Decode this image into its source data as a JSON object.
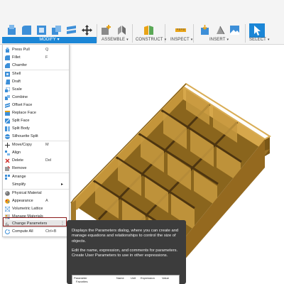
{
  "toolbar": {
    "groups": [
      {
        "label": "MODIFY"
      },
      {
        "label": "ASSEMBLE"
      },
      {
        "label": "CONSTRUCT"
      },
      {
        "label": "INSPECT"
      },
      {
        "label": "INSERT"
      },
      {
        "label": "SELECT"
      }
    ],
    "caret": "▾",
    "accent": "#1b86d6",
    "icons": [
      "press-pull-icon",
      "fillet-icon",
      "shell-icon",
      "combine-icon",
      "offset-face-icon",
      "move-icon",
      "new-component-icon",
      "joint-icon",
      "offset-plane-icon",
      "measure-icon",
      "insert-derive-icon",
      "insert-mesh-icon",
      "canvas-icon",
      "select-icon"
    ]
  },
  "menu": {
    "items": [
      {
        "label": "Press Pull",
        "shortcut": "Q",
        "icon": "press-pull-icon"
      },
      {
        "label": "Fillet",
        "shortcut": "F",
        "icon": "fillet-icon"
      },
      {
        "label": "Chamfer",
        "shortcut": "",
        "icon": "chamfer-icon"
      },
      {
        "label": "Shell",
        "shortcut": "",
        "icon": "shell-icon"
      },
      {
        "label": "Draft",
        "shortcut": "",
        "icon": "draft-icon"
      },
      {
        "label": "Scale",
        "shortcut": "",
        "icon": "scale-icon"
      },
      {
        "label": "Combine",
        "shortcut": "",
        "icon": "combine-icon"
      },
      {
        "label": "Offset Face",
        "shortcut": "",
        "icon": "offset-face-icon"
      },
      {
        "label": "Replace Face",
        "shortcut": "",
        "icon": "replace-face-icon"
      },
      {
        "label": "Split Face",
        "shortcut": "",
        "icon": "split-face-icon"
      },
      {
        "label": "Split Body",
        "shortcut": "",
        "icon": "split-body-icon"
      },
      {
        "label": "Silhouette Split",
        "shortcut": "",
        "icon": "silhouette-split-icon"
      },
      {
        "label": "Move/Copy",
        "shortcut": "M",
        "icon": "move-copy-icon"
      },
      {
        "label": "Align",
        "shortcut": "",
        "icon": "align-icon"
      },
      {
        "label": "Delete",
        "shortcut": "Del",
        "icon": "delete-icon"
      },
      {
        "label": "Remove",
        "shortcut": "",
        "icon": "remove-icon"
      },
      {
        "label": "Arrange",
        "shortcut": "",
        "icon": "arrange-icon"
      },
      {
        "label": "Simplify",
        "shortcut": "",
        "icon": ""
      },
      {
        "label": "Physical Material",
        "shortcut": "",
        "icon": "physical-material-icon"
      },
      {
        "label": "Appearance",
        "shortcut": "A",
        "icon": "appearance-icon"
      },
      {
        "label": "Volumetric Lattice",
        "shortcut": "",
        "icon": "volumetric-lattice-icon"
      },
      {
        "label": "Manage Materials",
        "shortcut": "",
        "icon": "manage-materials-icon"
      },
      {
        "label": "Change Parameters",
        "shortcut": "",
        "icon": "change-parameters-icon"
      },
      {
        "label": "Compute All",
        "shortcut": "Ctrl+B",
        "icon": "compute-all-icon"
      }
    ],
    "submenu_arrow": "▸",
    "more_glyph": "⋮"
  },
  "tooltip": {
    "para1": "Displays the Parameters dialog, where you can create and manage equations and relationships to control the size of objects.",
    "para2": "Edit the name, expression, and comments for parameters. Create User Parameters to use in other expressions.",
    "preview_headers": [
      "Parameter",
      "Name",
      "Unit",
      "Expression",
      "Value"
    ],
    "preview_row": "Favorites"
  },
  "model": {
    "color": "#b5882f"
  }
}
